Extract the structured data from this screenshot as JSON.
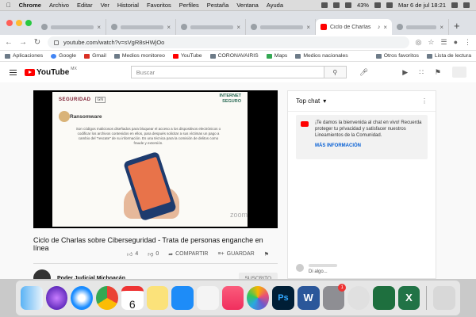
{
  "menubar": {
    "app": "Chrome",
    "items": [
      "Archivo",
      "Editar",
      "Ver",
      "Historial",
      "Favoritos",
      "Perfiles",
      "Pestaña",
      "Ventana",
      "Ayuda"
    ],
    "battery": "43%",
    "datetime": "Mar 6 de jul  18:21"
  },
  "tabs": {
    "active_title": "Ciclo de Charlas"
  },
  "address": {
    "url": "youtube.com/watch?v=sVgR8sHWjOo"
  },
  "bookmarks": {
    "items": [
      "Aplicaciones",
      "Google",
      "Gmail",
      "Medios monitoreo",
      "YouTube",
      "CORONAVAIRIS",
      "Maps",
      "Medios nacionales"
    ],
    "right": [
      "Otros favoritos",
      "Lista de lectura"
    ]
  },
  "youtube": {
    "logo": "YouTube",
    "region": "MX",
    "search_placeholder": "Buscar"
  },
  "slide": {
    "brand": "SEGURIDAD",
    "gn": "GN",
    "internet_line1": "INTERNET",
    "internet_line2": "SEGURO",
    "heading": "Ransomware",
    "text": "Son códigos maliciosos diseñados para bloquear el acceso a los dispositivos electrónicos o codificar los archivos contenidos en ellos, para después solicitar a sus víctimas un pago a cambio del \"rescate\" de su información. Es una técnica para la comisión de delitos como fraude y extorsión.",
    "watermark": "zoom"
  },
  "video": {
    "title": "Ciclo de Charlas sobre Ciberseguridad - Trata de personas enganche en línea",
    "likes": "4",
    "dislikes": "0",
    "share": "COMPARTIR",
    "save": "GUARDAR",
    "channel": "Poder Judicial Michoacán",
    "subscribe": "SUSCRITO"
  },
  "chat": {
    "header": "Top chat",
    "welcome": "¡Te damos la bienvenida al chat en vivo! Recuerda proteger tu privacidad y satisfacer nuestros Lineamientos de la Comunidad.",
    "more": "MÁS INFORMACIÓN",
    "message": "Di algo..."
  },
  "dock": {
    "calendar_day": "6",
    "badge": "1",
    "word_letter": "W",
    "excel_letter": "X",
    "ps_letter": "Ps"
  }
}
